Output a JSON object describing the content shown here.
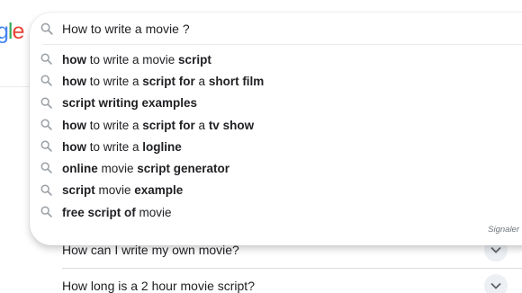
{
  "logo": {
    "visible_text": "gle",
    "colors": [
      "#4285f4",
      "#34a853",
      "#ea4335"
    ]
  },
  "search": {
    "value": "How to write a movie ?",
    "icon": "search-icon"
  },
  "suggestions": [
    {
      "parts": [
        {
          "t": "how",
          "b": true
        },
        {
          "t": " to write a movie ",
          "b": false
        },
        {
          "t": "script",
          "b": true
        }
      ]
    },
    {
      "parts": [
        {
          "t": "how",
          "b": true
        },
        {
          "t": " to write a ",
          "b": false
        },
        {
          "t": "script for",
          "b": true
        },
        {
          "t": " a ",
          "b": false
        },
        {
          "t": "short film",
          "b": true
        }
      ]
    },
    {
      "parts": [
        {
          "t": "script writing examples",
          "b": true
        }
      ]
    },
    {
      "parts": [
        {
          "t": "how",
          "b": true
        },
        {
          "t": " to write a ",
          "b": false
        },
        {
          "t": "script for",
          "b": true
        },
        {
          "t": " a ",
          "b": false
        },
        {
          "t": "tv show",
          "b": true
        }
      ]
    },
    {
      "parts": [
        {
          "t": "how",
          "b": true
        },
        {
          "t": " to write a ",
          "b": false
        },
        {
          "t": "logline",
          "b": true
        }
      ]
    },
    {
      "parts": [
        {
          "t": "online",
          "b": true
        },
        {
          "t": " movie ",
          "b": false
        },
        {
          "t": "script generator",
          "b": true
        }
      ]
    },
    {
      "parts": [
        {
          "t": "script",
          "b": true
        },
        {
          "t": " movie ",
          "b": false
        },
        {
          "t": "example",
          "b": true
        }
      ]
    },
    {
      "parts": [
        {
          "t": "free script of",
          "b": true
        },
        {
          "t": " movie",
          "b": false
        }
      ]
    }
  ],
  "report_label": "Signaler",
  "related_questions": [
    {
      "text": "How can I write my own movie?"
    },
    {
      "text": "How long is a 2 hour movie script?"
    }
  ]
}
